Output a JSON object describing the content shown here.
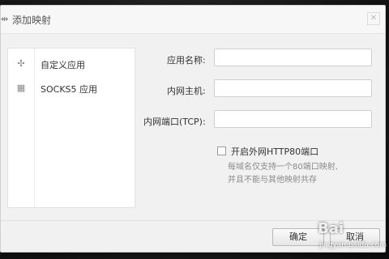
{
  "dialog": {
    "title_icon": "link-icon",
    "title": "添加映射",
    "close_icon": "close-icon"
  },
  "sidebar": {
    "items": [
      {
        "icon": "move-cross-icon",
        "label": "自定义应用"
      },
      {
        "icon": "grid-icon",
        "label": "SOCKS5 应用"
      }
    ]
  },
  "form": {
    "app_name_label": "应用名称:",
    "app_name_value": "",
    "host_label": "内网主机:",
    "host_value": "",
    "port_label": "内网端口(TCP):",
    "port_value": "",
    "http80_label": "开启外网HTTP80端口",
    "http80_checked": false,
    "hint_line1": "每域名仅支持一个80端口映射,",
    "hint_line2": "并且不能与其他映射共存"
  },
  "footer": {
    "ok_label": "确定",
    "cancel_label": "取消"
  },
  "watermark": {
    "text": "Bai",
    "subtext": "jingyan.baidu.com"
  }
}
